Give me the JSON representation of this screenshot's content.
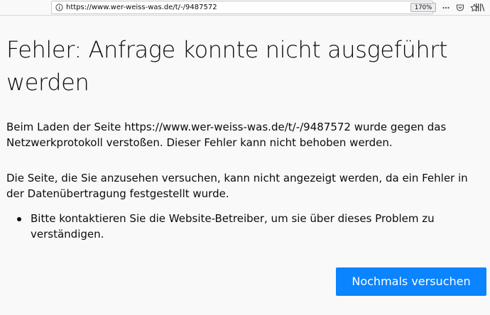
{
  "browser": {
    "url": "https://www.wer-weiss-was.de/t/-/9487572",
    "zoom": "170%",
    "icons": [
      "info-icon",
      "page-actions-icon",
      "pocket-icon",
      "bookmark-star-icon",
      "library-icon"
    ]
  },
  "error_page": {
    "title": "Fehler: Anfrage konnte nicht ausgeführt werden",
    "paragraph1": "Beim Laden der Seite https://www.wer-weiss-was.de/t/-/9487572 wurde gegen das Netzwerkprotokoll verstoßen. Dieser Fehler kann nicht behoben werden.",
    "paragraph2": "Die Seite, die Sie anzusehen versuchen, kann nicht angezeigt werden, da ein Fehler in der Datenübertragung festgestellt wurde.",
    "bullets": [
      "Bitte kontaktieren Sie die Website-Betreiber, um sie über dieses Problem zu verständigen."
    ],
    "retry_button_label": "Nochmals versuchen"
  },
  "colors": {
    "accent": "#0a84ff",
    "background": "#f9f9fa",
    "text": "#0c0c0d"
  }
}
